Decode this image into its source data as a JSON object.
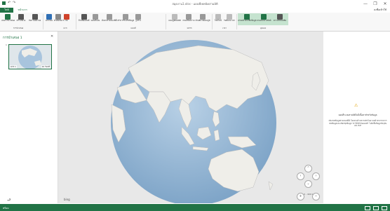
{
  "window": {
    "title": "สมุดงาน1.xlsx - แผนที่เทคนิคสามมิติ",
    "min_glyph": "—",
    "max_glyph": "❐",
    "close_glyph": "✕"
  },
  "tabs": {
    "file": "ไฟล์",
    "home": "หน้าแรก"
  },
  "signin": "ลงชื่อเข้าใช้",
  "ribbon": {
    "buttons": [
      {
        "label": "เล่นการนำเสนอ",
        "icon": "play-icon"
      },
      {
        "label": "สร้างวิดีโอ",
        "icon": "video-icon"
      },
      {
        "label": "จับภาพหน้าจอ",
        "icon": "camera-icon"
      },
      {
        "label": "ฉากใหม่",
        "icon": "new-scene-icon"
      },
      {
        "label": "ตัวเลือกฉาก",
        "icon": "scene-options-icon"
      },
      {
        "label": "ธีม",
        "icon": "theme-icon"
      },
      {
        "label": "ป้ายชื่อแผนที่",
        "icon": "map-labels-icon"
      },
      {
        "label": "แผนที่แบน",
        "icon": "flat-map-icon"
      },
      {
        "label": "ค้นหาตำแหน่งที่ตั้ง",
        "icon": "find-location-icon"
      },
      {
        "label": "ทำการรีเฟรชข้อมูล",
        "icon": "refresh-icon"
      },
      {
        "label": "รูปร่าง",
        "icon": "shapes-icon"
      },
      {
        "label": "แผนภูมิสองมิติ",
        "icon": "chart-icon"
      },
      {
        "label": "กล่องข้อความ",
        "icon": "textbox-icon"
      },
      {
        "label": "คำอธิบายแผนภูมิ",
        "icon": "legend-icon"
      },
      {
        "label": "ไทม์ไลน์",
        "icon": "timeline-icon"
      },
      {
        "label": "วันที่และเวลา",
        "icon": "datetime-icon"
      },
      {
        "label": "บานหน้าต่างชั้นข้อมูล",
        "icon": "layer-pane-icon"
      },
      {
        "label": "บานหน้าต่างฟิลด์",
        "icon": "field-list-icon"
      },
      {
        "label": "ความช่วยเหลือ",
        "icon": "help-icon"
      }
    ],
    "groups": [
      "การนำเสนอ",
      "ฉาก",
      "แผนที่",
      "แทรก",
      "เวลา",
      "มุมมอง"
    ]
  },
  "tour": {
    "title": "การนำเสนอ 1",
    "close_glyph": "✕",
    "scene_number": "1",
    "scene_label": "ฉาก 1",
    "scene_duration": "10 วินาที"
  },
  "map": {
    "bing": "bing",
    "scale": "0 - 400 km"
  },
  "nav": {
    "up": "⌃",
    "left": "‹",
    "right": "›",
    "down": "⌄",
    "plus": "+",
    "minus": "−"
  },
  "right_pane": {
    "warning_glyph": "⚠",
    "warning_title": "แผนที่ระบบสามมิติไม่มีเนื้อหาสำหรับข้อมูล",
    "warning_body": "เพิ่มเขตข้อมูลตำแหน่งที่ตั้ง โดยทางด้านขวาคลิกในบานหน้าต่างรายการเขตข้อมูลและเลือกชุดข้อมูล \"ทำให้เข้ากับแผนที่\" ไปยังชั้นข้อมูลปัจจุบัน และ ลิงก์"
  },
  "status": {
    "ready": "พร้อม"
  },
  "colors": {
    "accent": "#217346",
    "ocean": "#a8c4dd",
    "land": "#efeee9"
  }
}
